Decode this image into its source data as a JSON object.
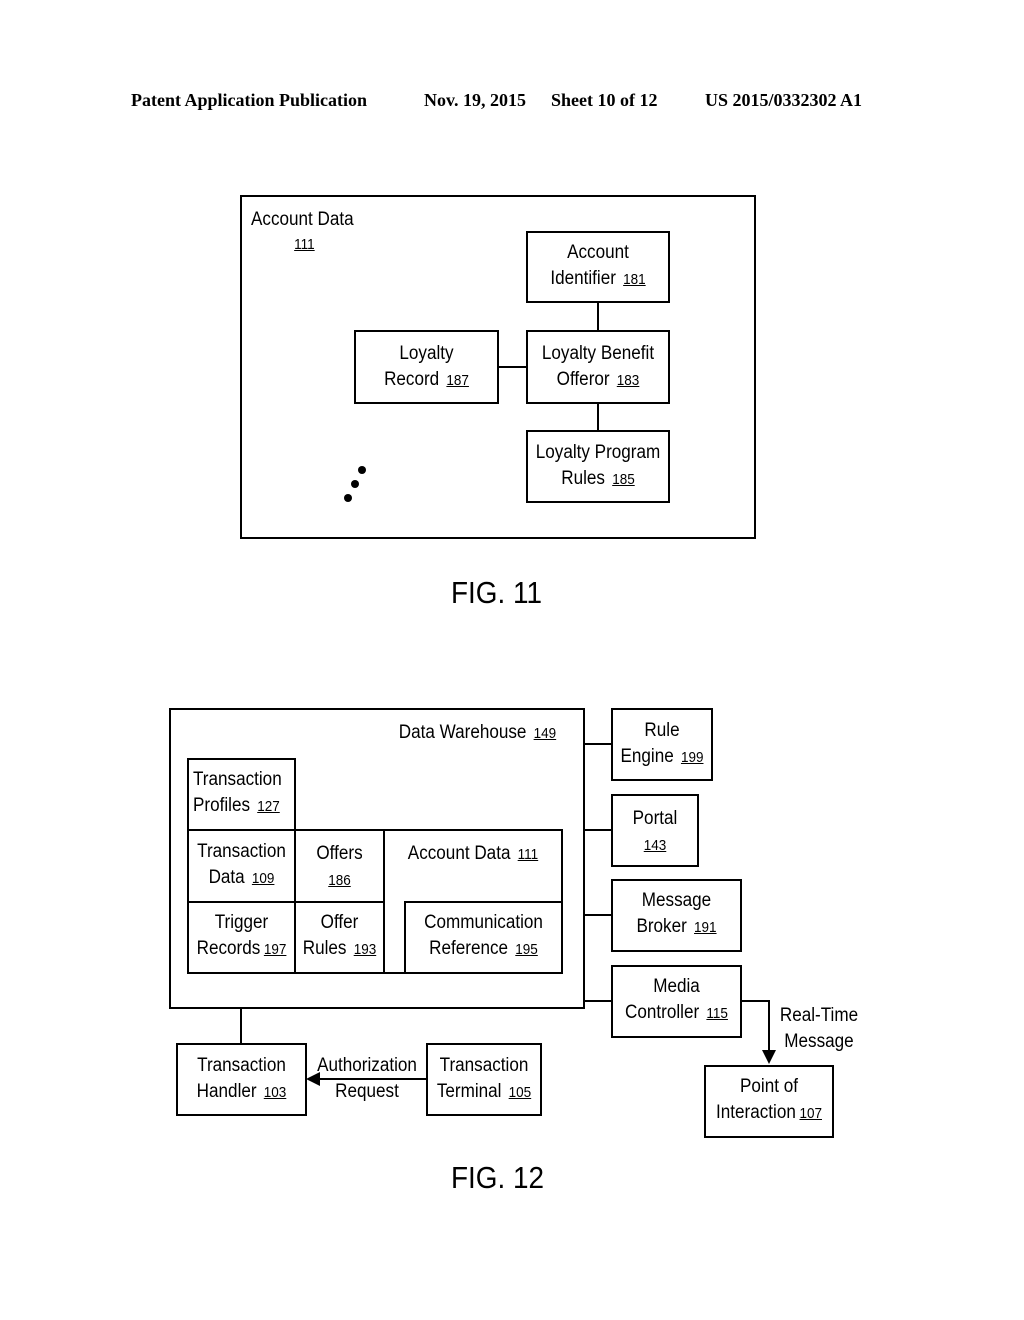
{
  "header": {
    "publication": "Patent Application Publication",
    "date": "Nov. 19, 2015",
    "sheet": "Sheet 10 of 12",
    "number": "US 2015/0332302 A1"
  },
  "fig11": {
    "caption": "FIG. 11",
    "container": {
      "title": "Account Data",
      "ref": "111"
    },
    "account_identifier": {
      "line1": "Account",
      "line2": "Identifier",
      "ref": "181"
    },
    "loyalty_benefit_offeror": {
      "line1": "Loyalty Benefit",
      "line2": "Offeror",
      "ref": "183"
    },
    "loyalty_record": {
      "line1": "Loyalty",
      "line2": "Record",
      "ref": "187"
    },
    "loyalty_program_rules": {
      "line1": "Loyalty Program",
      "line2": "Rules",
      "ref": "185"
    },
    "ellipsis": "more items"
  },
  "fig12": {
    "caption": "FIG. 12",
    "data_warehouse": {
      "title": "Data Warehouse",
      "ref": "149"
    },
    "transaction_profiles": {
      "line1": "Transaction",
      "line2": "Profiles",
      "ref": "127"
    },
    "transaction_data": {
      "line1": "Transaction",
      "line2": "Data",
      "ref": "109"
    },
    "offers": {
      "line1": "Offers",
      "ref": "186"
    },
    "account_data": {
      "line1": "Account Data",
      "ref": "111"
    },
    "trigger_records": {
      "line1": "Trigger",
      "line2": "Records",
      "ref": "197"
    },
    "offer_rules": {
      "line1": "Offer",
      "line2": "Rules",
      "ref": "193"
    },
    "communication_reference": {
      "line1": "Communication",
      "line2": "Reference",
      "ref": "195"
    },
    "rule_engine": {
      "line1": "Rule",
      "line2": "Engine",
      "ref": "199"
    },
    "portal": {
      "line1": "Portal",
      "ref": "143"
    },
    "message_broker": {
      "line1": "Message",
      "line2": "Broker",
      "ref": "191"
    },
    "media_controller": {
      "line1": "Media",
      "line2": "Controller",
      "ref": "115"
    },
    "real_time_message": {
      "line1": "Real-Time",
      "line2": "Message"
    },
    "point_of_interaction": {
      "line1": "Point of",
      "line2": "Interaction",
      "ref": "107"
    },
    "transaction_handler": {
      "line1": "Transaction",
      "line2": "Handler",
      "ref": "103"
    },
    "authorization_request": {
      "line1": "Authorization",
      "line2": "Request"
    },
    "transaction_terminal": {
      "line1": "Transaction",
      "line2": "Terminal",
      "ref": "105"
    }
  }
}
